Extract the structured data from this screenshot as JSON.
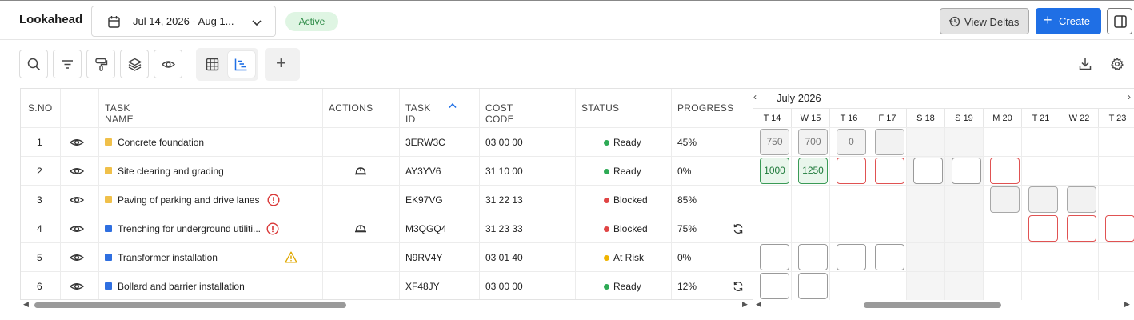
{
  "header": {
    "title": "Lookahead",
    "date_range": "Jul 14, 2026 - Aug 1...",
    "status_badge": "Active",
    "view_deltas_label": "View Deltas",
    "create_label": "Create"
  },
  "toolbar": {
    "icons": [
      "search-icon",
      "filter-icon",
      "paint-roller-icon",
      "layers-icon",
      "eye-icon"
    ],
    "views": [
      "grid-view-icon",
      "gantt-view-icon"
    ],
    "add_view": "+"
  },
  "table": {
    "columns": [
      "S.NO",
      "",
      "TASK NAME",
      "ACTIONS",
      "TASK ID",
      "COST CODE",
      "STATUS",
      "PROGRESS"
    ],
    "sort_indicator": "^",
    "rows": [
      {
        "sno": "1",
        "name": "Concrete foundation",
        "color": "#f0c04a",
        "action_icon": "",
        "alert": "",
        "task_id": "3ERW3C",
        "cost_code": "03 00 00",
        "status": "Ready",
        "status_color": "#2eaa55",
        "progress": "45%",
        "sync": false
      },
      {
        "sno": "2",
        "name": "Site clearing and grading",
        "color": "#f0c04a",
        "action_icon": "hard-hat",
        "alert": "",
        "task_id": "AY3YV6",
        "cost_code": "31 10 00",
        "status": "Ready",
        "status_color": "#2eaa55",
        "progress": "0%",
        "sync": false
      },
      {
        "sno": "3",
        "name": "Paving of parking and drive lanes",
        "color": "#f0c04a",
        "action_icon": "",
        "alert": "error",
        "task_id": "EK97VG",
        "cost_code": "31 22 13",
        "status": "Blocked",
        "status_color": "#e04545",
        "progress": "85%",
        "sync": false
      },
      {
        "sno": "4",
        "name": "Trenching for underground utiliti...",
        "color": "#2f6fe0",
        "action_icon": "hard-hat",
        "alert": "error",
        "task_id": "M3QGQ4",
        "cost_code": "31 23 33",
        "status": "Blocked",
        "status_color": "#e04545",
        "progress": "75%",
        "sync": true
      },
      {
        "sno": "5",
        "name": "Transformer installation",
        "color": "#2f6fe0",
        "action_icon": "",
        "alert": "warning",
        "task_id": "N9RV4Y",
        "cost_code": "03 01 40",
        "status": "At Risk",
        "status_color": "#f0b400",
        "progress": "0%",
        "sync": false
      },
      {
        "sno": "6",
        "name": "Bollard and barrier installation",
        "color": "#2f6fe0",
        "action_icon": "",
        "alert": "",
        "task_id": "XF48JY",
        "cost_code": "03 00 00",
        "status": "Ready",
        "status_color": "#2eaa55",
        "progress": "12%",
        "sync": true
      }
    ]
  },
  "gantt": {
    "month": "July 2026",
    "prev": "‹",
    "next": "›",
    "days": [
      "T 14",
      "W 15",
      "T 16",
      "F 17",
      "S 18",
      "S 19",
      "M 20",
      "T 21",
      "W 22",
      "T 23"
    ],
    "weekend_days": [
      4,
      5
    ],
    "rows": [
      [
        {
          "d": 0,
          "k": "grey",
          "v": "750"
        },
        {
          "d": 1,
          "k": "grey",
          "v": "700"
        },
        {
          "d": 2,
          "k": "grey",
          "v": "0"
        },
        {
          "d": 3,
          "k": "grey",
          "v": ""
        }
      ],
      [
        {
          "d": 0,
          "k": "green",
          "v": "1000"
        },
        {
          "d": 1,
          "k": "green",
          "v": "1250"
        },
        {
          "d": 2,
          "k": "red",
          "v": ""
        },
        {
          "d": 3,
          "k": "red",
          "v": ""
        },
        {
          "d": 4,
          "k": "empty",
          "v": ""
        },
        {
          "d": 5,
          "k": "empty",
          "v": ""
        },
        {
          "d": 6,
          "k": "red",
          "v": ""
        }
      ],
      [
        {
          "d": 6,
          "k": "grey",
          "v": ""
        },
        {
          "d": 7,
          "k": "grey",
          "v": ""
        },
        {
          "d": 8,
          "k": "grey",
          "v": ""
        }
      ],
      [
        {
          "d": 7,
          "k": "red",
          "v": ""
        },
        {
          "d": 8,
          "k": "red",
          "v": ""
        },
        {
          "d": 9,
          "k": "red",
          "v": ""
        }
      ],
      [
        {
          "d": 0,
          "k": "empty",
          "v": ""
        },
        {
          "d": 1,
          "k": "empty",
          "v": ""
        },
        {
          "d": 2,
          "k": "empty",
          "v": ""
        },
        {
          "d": 3,
          "k": "empty",
          "v": ""
        }
      ],
      [
        {
          "d": 0,
          "k": "empty",
          "v": ""
        },
        {
          "d": 1,
          "k": "empty",
          "v": ""
        }
      ]
    ]
  }
}
